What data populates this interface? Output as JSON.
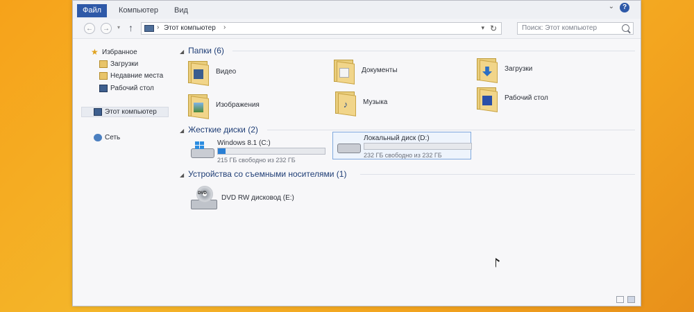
{
  "ribbon": {
    "tabs": [
      "Файл",
      "Компьютер",
      "Вид"
    ],
    "help": "?"
  },
  "address": {
    "breadcrumb": "Этот компьютер",
    "search_placeholder": "Поиск: Этот компьютер"
  },
  "nav": {
    "favorites": "Избранное",
    "downloads": "Загрузки",
    "recent": "Недавние места",
    "desktop": "Рабочий стол",
    "this_pc": "Этот компьютер",
    "network": "Сеть"
  },
  "groups": {
    "folders": "Папки (6)",
    "drives": "Жесткие диски (2)",
    "removable": "Устройства со съемными носителями (1)"
  },
  "folders": [
    {
      "label": "Видео",
      "icon": "video-folder-icon"
    },
    {
      "label": "Документы",
      "icon": "documents-folder-icon"
    },
    {
      "label": "Загрузки",
      "icon": "downloads-folder-icon"
    },
    {
      "label": "Изображения",
      "icon": "pictures-folder-icon"
    },
    {
      "label": "Музыка",
      "icon": "music-folder-icon"
    },
    {
      "label": "Рабочий стол",
      "icon": "desktop-folder-icon"
    }
  ],
  "drives": [
    {
      "name": "Windows 8.1 (C:)",
      "free": "215 ГБ свободно из 232 ГБ",
      "used_fraction": 0.07
    },
    {
      "name": "Локальный диск (D:)",
      "free": "232 ГБ свободно из 232 ГБ",
      "used_fraction": 0.0
    }
  ],
  "removable": [
    {
      "name": "DVD RW дисковод (E:)",
      "icon_text": "DVD"
    }
  ],
  "colors": {
    "accent": "#2e59a8",
    "progress": "#2a7fd4",
    "group_header": "#1e3d75"
  }
}
